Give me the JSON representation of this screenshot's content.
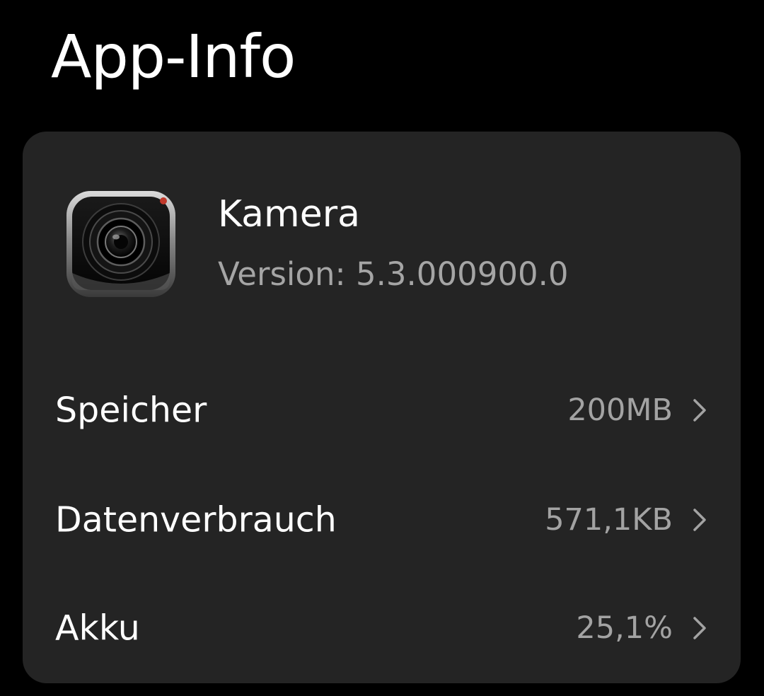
{
  "header": {
    "title": "App-Info"
  },
  "app": {
    "name": "Kamera",
    "version": "Version: 5.3.000900.0",
    "icon": "camera-lens-icon"
  },
  "rows": [
    {
      "label": "Speicher",
      "value": "200MB",
      "icon": "chevron-right-icon"
    },
    {
      "label": "Datenverbrauch",
      "value": "571,1KB",
      "icon": "chevron-right-icon"
    },
    {
      "label": "Akku",
      "value": "25,1%",
      "icon": "chevron-right-icon"
    }
  ],
  "colors": {
    "background": "#000000",
    "card": "#242424",
    "primary_text": "#ffffff",
    "secondary_text": "#a5a5a5"
  }
}
